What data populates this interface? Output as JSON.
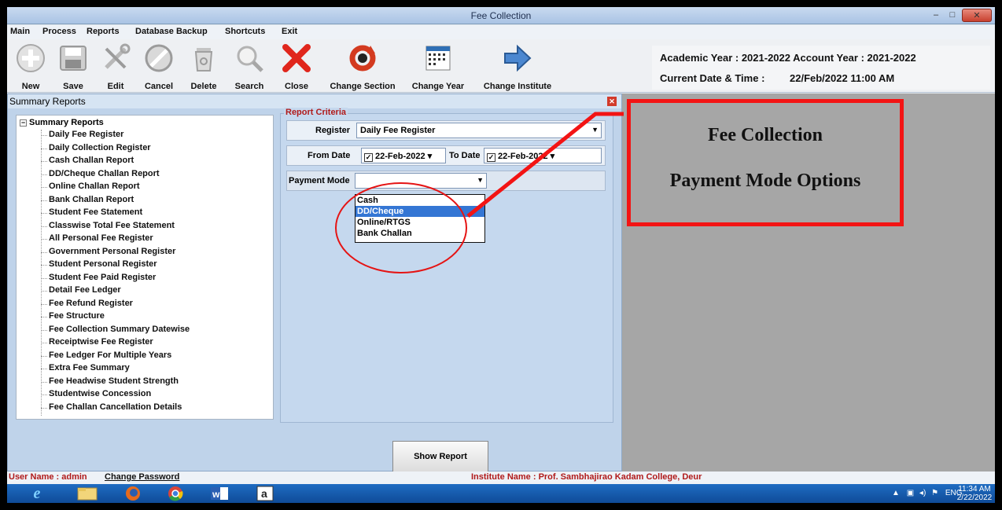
{
  "window": {
    "title": "Fee Collection",
    "min": "–",
    "max": "□",
    "close": "✕"
  },
  "menu": [
    "Main",
    "Process",
    "Reports",
    "Database Backup",
    "Shortcuts",
    "Exit"
  ],
  "toolbar": {
    "buttons": [
      {
        "label": "New",
        "icon": "plus-circle-icon"
      },
      {
        "label": "Save",
        "icon": "floppy-icon"
      },
      {
        "label": "Edit",
        "icon": "tools-icon"
      },
      {
        "label": "Cancel",
        "icon": "cancel-icon"
      },
      {
        "label": "Delete",
        "icon": "trash-icon"
      },
      {
        "label": "Search",
        "icon": "magnifier-icon"
      },
      {
        "label": "Close",
        "icon": "red-x-icon"
      },
      {
        "label": "Change Section",
        "icon": "refresh-icon"
      },
      {
        "label": "Change Year",
        "icon": "calendar-icon"
      },
      {
        "label": "Change Institute",
        "icon": "arrow-right-icon"
      }
    ],
    "academic_year": "Academic Year : 2021-2022 Account Year : 2021-2022",
    "datetime_label": "Current Date & Time :",
    "datetime_value": "22/Feb/2022 11:00 AM"
  },
  "summary_panel": {
    "title": "Summary Reports",
    "tree_root": "Summary Reports",
    "tree_toggle": "−",
    "reports": [
      "Daily Fee Register",
      "Daily Collection Register",
      "Cash Challan Report",
      "DD/Cheque Challan Report",
      "Online Challan Report",
      "Bank Challan Report",
      "Student Fee Statement",
      "Classwise Total Fee Statement",
      "All Personal Fee Register",
      "Government Personal Register",
      "Student Personal Register",
      "Student Fee Paid Register",
      "Detail Fee Ledger",
      "Fee Refund Register",
      "Fee Structure",
      "Fee Collection Summary Datewise",
      "Receiptwise Fee Register",
      "Fee Ledger For Multiple Years",
      "Extra Fee Summary",
      "Fee Headwise Student Strength",
      "Studentwise Concession",
      "Fee Challan Cancellation Details"
    ]
  },
  "criteria": {
    "title": "Report Criteria",
    "register_label": "Register",
    "register_value": "Daily Fee Register",
    "from_date_label": "From Date",
    "from_date": "22-Feb-2022",
    "to_date_label": "To Date",
    "to_date": "22-Feb-2022",
    "payment_mode_label": "Payment Mode",
    "payment_mode_value": "",
    "payment_options": [
      "Cash",
      "DD/Cheque",
      "Online/RTGS",
      "Bank Challan"
    ],
    "selected_option": "DD/Cheque",
    "show_report": "Show Report"
  },
  "callout": {
    "line1": "Fee Collection",
    "line2": "Payment Mode Options"
  },
  "status": {
    "user": "User Name : admin",
    "change_password": "Change Password",
    "institute": "Institute Name : Prof. Sambhajirao Kadam College, Deur"
  },
  "taskbar": {
    "apps": [
      "ie-icon",
      "file-explorer-icon",
      "firefox-icon",
      "chrome-icon",
      "word-icon",
      "app-a-icon"
    ],
    "tray_lang": "ENG",
    "time": "11:34 AM",
    "date": "2/22/2022"
  },
  "colors": {
    "accent_red": "#f31414",
    "selection_blue": "#3476d4",
    "criteria_title": "#b01a1a"
  }
}
